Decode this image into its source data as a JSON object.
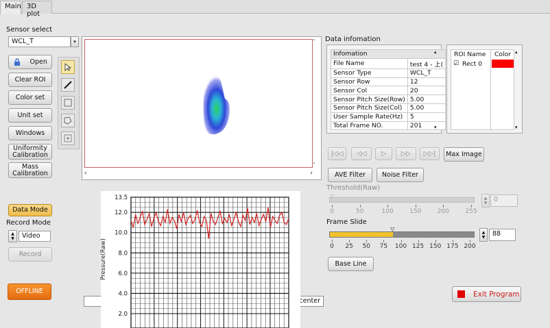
{
  "tabs": [
    {
      "label": "Main"
    },
    {
      "label": "3D plot"
    }
  ],
  "sensor_select": {
    "label": "Sensor select",
    "value": "WCL_T"
  },
  "buttons": {
    "open": "Open",
    "clear_roi": "Clear ROI",
    "color_set": "Color set",
    "unit_set": "Unit set",
    "windows": "Windows",
    "uniformity": "Uniformity\nCalibration",
    "mass": "Mass\nCalibration",
    "data_mode": "Data Mode",
    "record": "Record",
    "offline": "OFFLINE",
    "ave_filter": "AVE Filter",
    "noise_filter": "Noise Filter",
    "max_image": "Max Image",
    "base_line": "Base Line",
    "exit": "Exit Program"
  },
  "record_mode": {
    "label": "Record Mode",
    "value": "Video"
  },
  "data_info": {
    "title": "Data infomation",
    "header": "Infomation",
    "rows": [
      {
        "k": "File Name",
        "v": "test 4 - 上("
      },
      {
        "k": "Sensor Type",
        "v": "WCL_T"
      },
      {
        "k": "Sensor Row",
        "v": "12"
      },
      {
        "k": "Sensor Col",
        "v": "20"
      },
      {
        "k": "Sensor Pitch Size(Row)",
        "v": "5.00"
      },
      {
        "k": "Sensor Pitch Size(Col)",
        "v": "5.00"
      },
      {
        "k": "User Sample Rate(Hz)",
        "v": "5"
      },
      {
        "k": "Total Frame NO.",
        "v": "201"
      }
    ]
  },
  "roi": {
    "col_name": "ROI Name",
    "col_color": "Color",
    "rows": [
      {
        "name": "Rect 0",
        "checked": true,
        "color": "#ff0000"
      }
    ]
  },
  "threshold": {
    "label": "Threshold(Raw)",
    "value": "0",
    "ticks": [
      "0",
      "50",
      "100",
      "150",
      "200",
      "255"
    ],
    "level": 0
  },
  "frame_slide": {
    "label": "Frame Slide",
    "value": "88",
    "ticks": [
      "0",
      "25",
      "50",
      "75",
      "100",
      "125",
      "150",
      "175",
      "200"
    ],
    "level": 0.44
  },
  "status_field": {
    "text": "t center"
  },
  "chart_data": {
    "type": "line",
    "ylabel": "Pressure(Raw)",
    "ylim": [
      2.0,
      13.5
    ],
    "yticks": [
      "13.5",
      "12.0",
      "10.0",
      "8.0",
      "6.0",
      "4.0",
      "2.0"
    ],
    "series": [
      {
        "values": [
          11.2,
          10.5,
          11.8,
          10.9,
          11.5,
          12.1,
          10.8,
          11.3,
          11.9,
          10.6,
          11.4,
          12.0,
          11.1,
          10.7,
          11.6,
          11.0,
          12.3,
          10.9,
          11.5,
          11.2,
          10.4,
          11.8,
          11.1,
          12.0,
          10.8,
          11.4,
          11.7,
          10.9,
          11.3,
          12.2,
          11.0,
          10.6,
          11.6,
          11.2,
          9.4,
          11.9,
          11.1,
          10.8,
          11.5,
          12.1,
          10.9,
          11.4,
          11.0,
          11.8,
          10.7,
          11.3,
          12.0,
          11.1,
          10.6,
          11.7,
          11.2,
          12.4,
          10.8,
          11.5,
          11.0,
          11.9,
          10.7,
          11.3,
          11.8,
          11.1,
          12.5,
          10.5,
          11.6,
          11.2,
          10.9,
          11.7,
          12.0,
          11.0,
          10.8,
          11.4
        ]
      }
    ],
    "color": "#d42020"
  },
  "colors": {
    "data_mode": "#f3c45a",
    "offline": "#ee7a1c",
    "frame_fill": "#f2c12e",
    "exit_square": "#e00000"
  }
}
